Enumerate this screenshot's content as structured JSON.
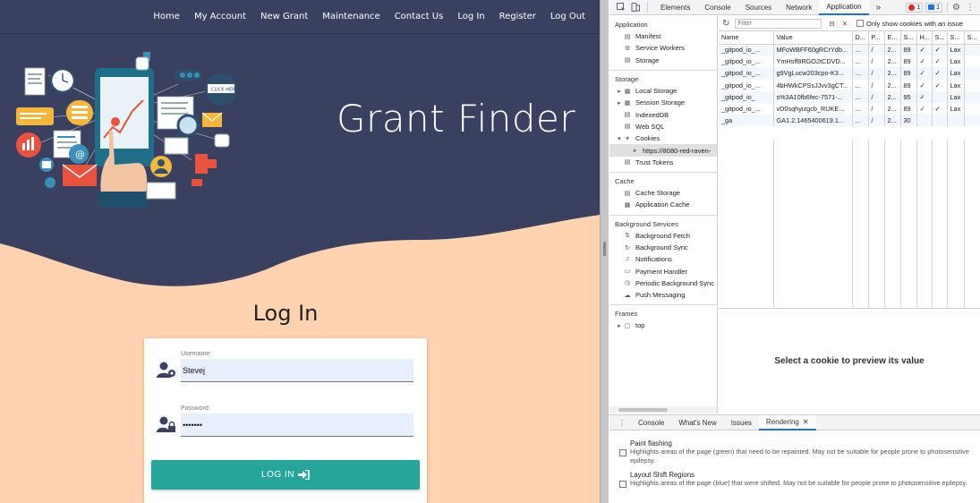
{
  "site": {
    "nav": [
      "Home",
      "My Account",
      "New Grant",
      "Maintenance",
      "Contact Us",
      "Log In",
      "Register",
      "Log Out"
    ],
    "brand": "Grant Finder",
    "illustration_badge": "CLICK HERE",
    "login_title": "Log In",
    "username_label": "Username:",
    "username_value": "Stevej",
    "password_label": "Password:",
    "password_value": "•••••••",
    "login_button": "LOG IN",
    "colors": {
      "header": "#3a4160",
      "page": "#ffd3af",
      "button": "#26a69a",
      "field": "#e8effc"
    }
  },
  "devtools": {
    "tabs": [
      "Elements",
      "Console",
      "Sources",
      "Network",
      "Application"
    ],
    "active_tab": "Application",
    "more_tabs": "»",
    "error_count": "1",
    "message_count": "1",
    "sidebar": {
      "application": {
        "heading": "Application",
        "items": [
          "Manifest",
          "Service Workers",
          "Storage"
        ]
      },
      "storage": {
        "heading": "Storage",
        "items": [
          "Local Storage",
          "Session Storage",
          "IndexedDB",
          "Web SQL",
          "Cookies",
          "https://8080-red-raven-",
          "Trust Tokens"
        ]
      },
      "cache": {
        "heading": "Cache",
        "items": [
          "Cache Storage",
          "Application Cache"
        ]
      },
      "background": {
        "heading": "Background Services",
        "items": [
          "Background Fetch",
          "Background Sync",
          "Notifications",
          "Payment Handler",
          "Periodic Background Sync",
          "Push Messaging"
        ]
      },
      "frames": {
        "heading": "Frames",
        "items": [
          "top"
        ]
      }
    },
    "toolbar": {
      "filter_placeholder": "Filter",
      "only_issue_label": "Only show cookies with an issue"
    },
    "columns": [
      "Name",
      "Value",
      "D...",
      "P...",
      "E...",
      "S...",
      "H...",
      "S...",
      "S...",
      "S..."
    ],
    "rows": [
      [
        "_gitpod_io_...",
        "MFoWBFF60gRCrYdb...",
        "...",
        "/",
        "2...",
        "89",
        "✓",
        "✓",
        "Lax",
        ""
      ],
      [
        "_gitpod_io_...",
        "YmHsff8RGO2tCDVD...",
        "...",
        "/",
        "2...",
        "89",
        "✓",
        "✓",
        "Lax",
        ""
      ],
      [
        "_gitpod_io_...",
        "g9VgLucw203cpo-K3...",
        "...",
        "/",
        "2...",
        "89",
        "✓",
        "✓",
        "Lax",
        ""
      ],
      [
        "_gitpod_io_...",
        "4bHWkCPSsJJvv3gCT...",
        "...",
        "/",
        "2...",
        "89",
        "✓",
        "✓",
        "Lax",
        ""
      ],
      [
        "_gitpod_io_",
        "s%3A10fb6fec-7571-...",
        "...",
        "/",
        "2...",
        "95",
        "✓",
        "",
        "Lax",
        ""
      ],
      [
        "_gitpod_io_...",
        "vD0sqhyizgcb_RUKE...",
        "...",
        "/",
        "2...",
        "89",
        "✓",
        "✓",
        "Lax",
        ""
      ],
      [
        "_ga",
        "GA1.2.1465400619.1...",
        "...",
        "/",
        "2...",
        "30",
        "",
        "",
        "",
        ""
      ]
    ],
    "preview_text": "Select a cookie to preview its value",
    "drawer": {
      "tabs": [
        "Console",
        "What's New",
        "Issues",
        "Rendering"
      ],
      "active": "Rendering",
      "options": [
        {
          "title": "Paint flashing",
          "desc": "Highlights areas of the page (green) that need to be repainted. May not be suitable for people prone to photosensitive epilepsy."
        },
        {
          "title": "Layout Shift Regions",
          "desc": "Highlights areas of the page (blue) that were shifted. May not be suitable for people prone to photosensitive epilepsy."
        }
      ]
    }
  }
}
